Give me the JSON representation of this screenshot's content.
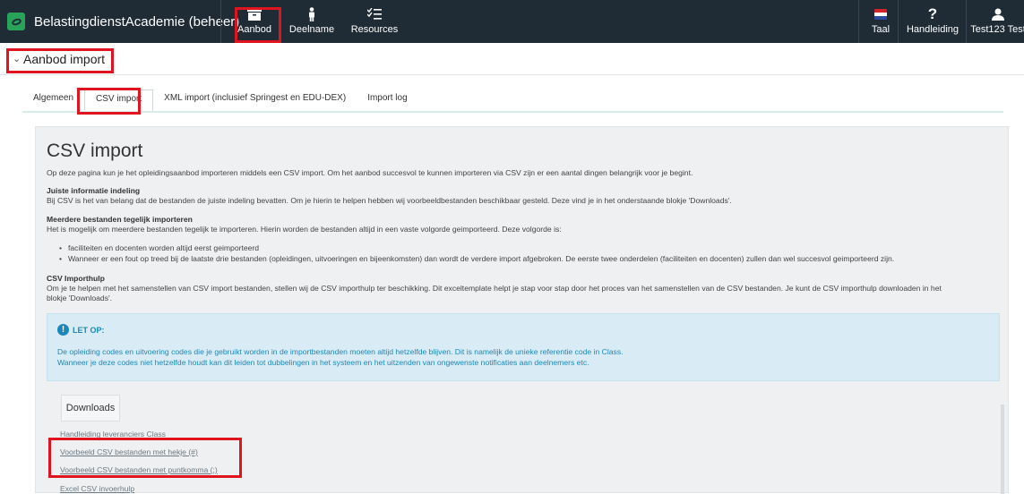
{
  "topbar": {
    "brand_title": "BelastingdienstAcademie (beheer)",
    "nav": [
      {
        "label": "Aanbod",
        "icon": "archive-box-icon"
      },
      {
        "label": "Deelname",
        "icon": "person-icon"
      },
      {
        "label": "Resources",
        "icon": "checklist-icon"
      }
    ],
    "right": [
      {
        "label": "Taal",
        "icon": "dutch-flag-icon"
      },
      {
        "label": "Handleiding",
        "icon": "question-mark-icon"
      },
      {
        "label": "Test123 Test",
        "icon": "user-icon"
      }
    ]
  },
  "section": {
    "title": "Aanbod import"
  },
  "tabs": [
    {
      "label": "Algemeen"
    },
    {
      "label": "CSV import"
    },
    {
      "label": "XML import (inclusief Springest en EDU-DEX)"
    },
    {
      "label": "Import log"
    }
  ],
  "content": {
    "title": "CSV import",
    "intro": "Op deze pagina kun je het opleidingsaanbod importeren middels een CSV import. Om het aanbod succesvol te kunnen importeren via CSV zijn er een aantal dingen belangrijk voor je begint.",
    "s1_head": "Juiste informatie indeling",
    "s1_text": "Bij CSV is het van belang dat de bestanden de juiste indeling bevatten. Om je hierin te helpen hebben wij voorbeeldbestanden beschikbaar gesteld. Deze vind je in het onderstaande blokje 'Downloads'.",
    "s2_head": "Meerdere bestanden tegelijk importeren",
    "s2_text": "Het is mogelijk om meerdere bestanden tegelijk te importeren. Hierin worden de bestanden altijd in een vaste volgorde geimporteerd. Deze volgorde is:",
    "bullets": [
      "faciliteiten en docenten worden altijd eerst geimporteerd",
      "Wanneer er een fout op treed bij de laatste drie bestanden (opleidingen, uitvoeringen en bijeenkomsten) dan wordt de verdere import afgebroken. De eerste twee onderdelen (faciliteiten en docenten) zullen dan wel succesvol geimporteerd zijn."
    ],
    "s3_head": "CSV Importhulp",
    "s3_text1": "Om je te helpen met het samenstellen van CSV import bestanden, stellen wij de CSV importhulp ter beschikking. Dit exceltemplate helpt je stap voor stap door het proces van het samenstellen van de CSV bestanden. Je kunt de CSV importhulp downloaden in het",
    "s3_text2": "blokje 'Downloads'."
  },
  "alert": {
    "icon": "exclamation-circle-icon",
    "title": "LET OP:",
    "line1": "De opleiding codes en uitvoering codes die je gebruikt worden in de importbestanden moeten altijd hetzelfde blijven. Dit is namelijk de unieke referentie code in Class.",
    "line2": "Wanneer je deze codes niet hetzelfde houdt kan dit leiden tot dubbelingen in het systeem en het uitzenden van ongewenste notificaties aan deelnemers etc."
  },
  "downloads": {
    "button_label": "Downloads",
    "links": [
      "Handleiding leveranciers Class",
      "Voorbeeld CSV bestanden met hekje (#)",
      "Voorbeeld CSV bestanden met puntkomma (;)",
      "Excel CSV invoerhulp"
    ]
  },
  "colors": {
    "topbar": "#1f2b35",
    "accent": "#1b87b8",
    "highlight": "#e0141e"
  }
}
